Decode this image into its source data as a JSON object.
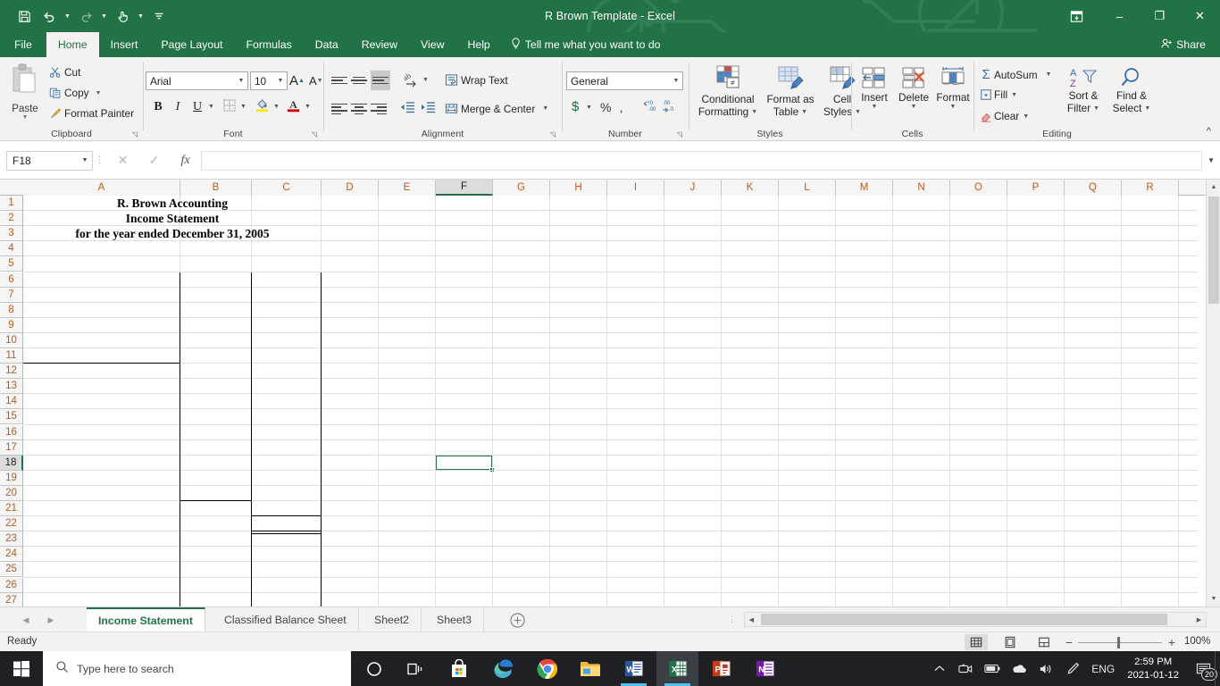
{
  "window": {
    "title": "R Brown Template  -  Excel",
    "quick_access": [
      "save-icon",
      "undo-icon",
      "redo-icon",
      "touch-mode-icon",
      "customize-qat-icon"
    ],
    "ribbon_display_options": "ribbon-display-options-icon",
    "minimize": "–",
    "restore": "❐",
    "close": "✕"
  },
  "ribbon_tabs": [
    {
      "label": "File",
      "active": false
    },
    {
      "label": "Home",
      "active": true
    },
    {
      "label": "Insert",
      "active": false
    },
    {
      "label": "Page Layout",
      "active": false
    },
    {
      "label": "Formulas",
      "active": false
    },
    {
      "label": "Data",
      "active": false
    },
    {
      "label": "Review",
      "active": false
    },
    {
      "label": "View",
      "active": false
    },
    {
      "label": "Help",
      "active": false
    }
  ],
  "tell_me": "Tell me what you want to do",
  "share": "Share",
  "ribbon": {
    "clipboard": {
      "label": "Clipboard",
      "paste": "Paste",
      "cut": "Cut",
      "copy": "Copy",
      "format_painter": "Format Painter"
    },
    "font": {
      "label": "Font",
      "font_name": "Arial",
      "font_size": "10",
      "grow_font": "A",
      "shrink_font": "A",
      "bold": "B",
      "italic": "I",
      "underline": "U"
    },
    "alignment": {
      "label": "Alignment",
      "wrap_text": "Wrap Text",
      "merge_center": "Merge & Center"
    },
    "number": {
      "label": "Number",
      "format": "General",
      "currency": "$",
      "percent": "%",
      "comma": "‚",
      "increase_decimal": ".00",
      "decrease_decimal": ".00"
    },
    "styles": {
      "label": "Styles",
      "conditional_formatting": "Conditional\nFormatting",
      "conditional_formatting_l1": "Conditional",
      "conditional_formatting_l2": "Formatting",
      "format_as_table_l1": "Format as",
      "format_as_table_l2": "Table",
      "cell_styles_l1": "Cell",
      "cell_styles_l2": "Styles"
    },
    "cells": {
      "label": "Cells",
      "insert": "Insert",
      "delete": "Delete",
      "format": "Format"
    },
    "editing": {
      "label": "Editing",
      "autosum": "AutoSum",
      "fill": "Fill",
      "clear": "Clear",
      "sort_filter_l1": "Sort &",
      "sort_filter_l2": "Filter",
      "find_select_l1": "Find &",
      "find_select_l2": "Select"
    }
  },
  "formula_bar": {
    "name_box": "F18",
    "cancel": "✕",
    "enter": "✓",
    "insert_function": "fx",
    "formula_value": "",
    "formula_placeholder": ""
  },
  "grid": {
    "columns": [
      "A",
      "B",
      "C",
      "D",
      "E",
      "F",
      "G",
      "H",
      "I",
      "J",
      "K",
      "L",
      "M",
      "N",
      "O",
      "P",
      "Q",
      "R"
    ],
    "selected_column": "F",
    "rows": [
      "1",
      "2",
      "3",
      "4",
      "5",
      "6",
      "7",
      "8",
      "9",
      "10",
      "11",
      "12",
      "13",
      "14",
      "15",
      "16",
      "17",
      "18",
      "19",
      "20",
      "21",
      "22",
      "23",
      "24",
      "25",
      "26",
      "27"
    ],
    "selected_row": "18",
    "selected_cell": "F18",
    "cells": [
      {
        "ref": "A1",
        "text": "R. Brown Accounting",
        "row": 1,
        "span_start": 0,
        "span_end": 3
      },
      {
        "ref": "A2",
        "text": "Income Statement",
        "row": 2,
        "span_start": 0,
        "span_end": 3
      },
      {
        "ref": "A3",
        "text": "for the year ended December 31, 2005",
        "row": 3,
        "span_start": 0,
        "span_end": 3
      }
    ]
  },
  "sheet_tabs": [
    {
      "label": "Income Statement",
      "active": true
    },
    {
      "label": "Classified Balance Sheet",
      "active": false
    },
    {
      "label": "Sheet2",
      "active": false
    },
    {
      "label": "Sheet3",
      "active": false
    }
  ],
  "add_sheet": "+",
  "status_bar": {
    "status": "Ready",
    "normal_view": "normal-view-icon",
    "page_layout_view": "page-layout-view-icon",
    "page_break_view": "page-break-view-icon",
    "zoom_out": "−",
    "zoom_in": "+",
    "zoom_level": "100%"
  },
  "taskbar": {
    "search_placeholder": "Type here to search",
    "apps": [
      "cortana-icon",
      "task-view-icon",
      "microsoft-store-icon",
      "edge-icon",
      "chrome-icon",
      "file-explorer-icon",
      "word-icon",
      "excel-icon",
      "powerpoint-icon",
      "onenote-icon"
    ],
    "tray": [
      "show-hidden-icons",
      "camera-icon",
      "battery-icon",
      "onedrive-icon",
      "volume-icon",
      "pen-icon"
    ],
    "language": "ENG",
    "time": "2:59 PM",
    "date": "2021-01-12",
    "notification_count": "20"
  },
  "colors": {
    "excel_green": "#217346",
    "ribbon_bg": "#f3f2f1",
    "header_text": "#b85c1e"
  }
}
